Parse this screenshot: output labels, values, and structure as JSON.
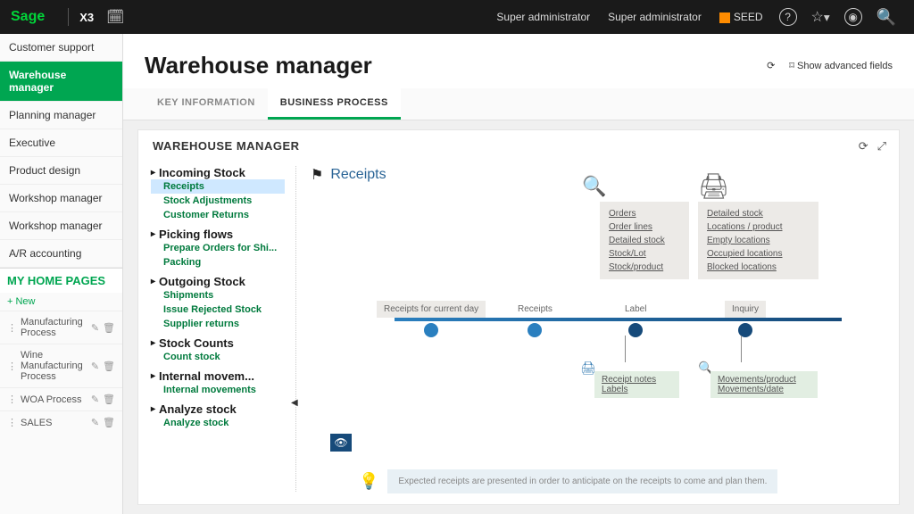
{
  "topbar": {
    "logo": "Sage",
    "product": "X3",
    "user1": "Super administrator",
    "user2": "Super administrator",
    "seed": "SEED"
  },
  "sidebar": {
    "items": [
      {
        "label": "Customer support",
        "active": false
      },
      {
        "label": "Warehouse manager",
        "active": true
      },
      {
        "label": "Planning manager",
        "active": false
      },
      {
        "label": "Executive",
        "active": false
      },
      {
        "label": "Product design",
        "active": false
      },
      {
        "label": "Workshop manager",
        "active": false
      },
      {
        "label": "Workshop manager",
        "active": false
      },
      {
        "label": "A/R accounting",
        "active": false
      }
    ],
    "home_header": "MY HOME PAGES",
    "new_label": "New",
    "home_items": [
      {
        "label": "Manufacturing Process"
      },
      {
        "label": "Wine Manufacturing Process"
      },
      {
        "label": "WOA Process"
      },
      {
        "label": "SALES"
      }
    ]
  },
  "page": {
    "title": "Warehouse manager",
    "show_advanced": "Show advanced fields",
    "tabs": [
      {
        "label": "KEY INFORMATION",
        "active": false
      },
      {
        "label": "BUSINESS PROCESS",
        "active": true
      }
    ]
  },
  "panel": {
    "title": "WAREHOUSE MANAGER",
    "tree": [
      {
        "head": "Incoming Stock",
        "links": [
          {
            "t": "Receipts",
            "sel": true
          },
          {
            "t": "Stock Adjustments"
          },
          {
            "t": "Customer Returns"
          }
        ]
      },
      {
        "head": "Picking flows",
        "links": [
          {
            "t": "Prepare Orders for Shi..."
          },
          {
            "t": "Packing"
          }
        ]
      },
      {
        "head": "Outgoing Stock",
        "links": [
          {
            "t": "Shipments"
          },
          {
            "t": "Issue Rejected Stock"
          },
          {
            "t": "Supplier returns"
          }
        ]
      },
      {
        "head": "Stock Counts",
        "links": [
          {
            "t": "Count stock"
          }
        ]
      },
      {
        "head": "Internal movem...",
        "links": [
          {
            "t": "Internal movements"
          }
        ]
      },
      {
        "head": "Analyze stock",
        "links": [
          {
            "t": "Analyze stock"
          }
        ]
      }
    ]
  },
  "diagram": {
    "title": "Receipts",
    "orders_box": [
      "Orders",
      "Order lines",
      "Detailed stock",
      "Stock/Lot",
      "Stock/product"
    ],
    "stock_box": [
      "Detailed stock",
      "Locations / product",
      "Empty locations",
      "Occupied locations",
      "Blocked locations"
    ],
    "steps": [
      {
        "label": "Receipts for current day",
        "boxed": true
      },
      {
        "label": "Receipts",
        "boxed": false
      },
      {
        "label": "Label",
        "boxed": false
      },
      {
        "label": "Inquiry",
        "boxed": true
      }
    ],
    "notes_box": [
      "Receipt notes",
      "Labels"
    ],
    "moves_box": [
      "Movements/product",
      "Movements/date"
    ],
    "tip": "Expected receipts are presented in order to anticipate on the receipts to come and plan them."
  }
}
